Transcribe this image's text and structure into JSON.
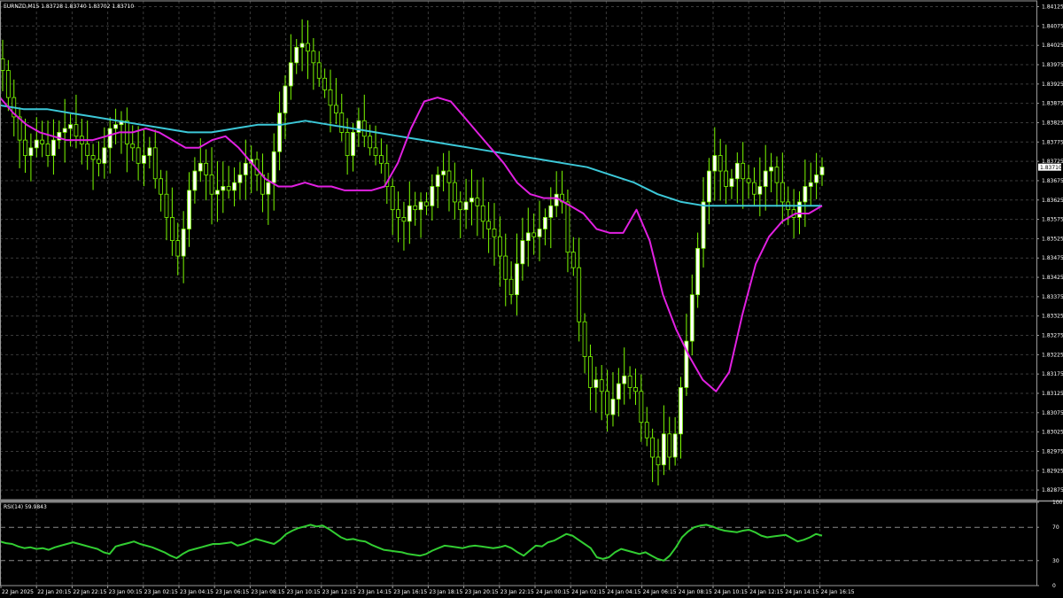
{
  "header": {
    "title": "EURNZD,M15  1.83728 1.83740 1.83702 1.83710"
  },
  "colors": {
    "background": "#000000",
    "grid": "#3a3a3a",
    "bull_candle": "#ffffff",
    "bear_candle": "#000000",
    "candle_outline": "#7cfc00",
    "ma_fast": "#e020e0",
    "ma_slow": "#3cc8d8",
    "rsi_line": "#32cd32",
    "price_tag_bg": "#ffffff",
    "price_tag_text": "#000000"
  },
  "chart_data": [
    {
      "type": "candlestick",
      "title": "EURNZD,M15  1.83728 1.83740 1.83702 1.83710",
      "ylim": [
        1.8285,
        1.8414
      ],
      "y_ticks": [
        "1.84125",
        "1.84075",
        "1.84025",
        "1.83975",
        "1.83925",
        "1.83875",
        "1.83825",
        "1.83775",
        "1.83725",
        "1.83675",
        "1.83625",
        "1.83575",
        "1.83525",
        "1.83475",
        "1.83425",
        "1.83375",
        "1.83325",
        "1.83275",
        "1.83225",
        "1.83175",
        "1.83125",
        "1.83075",
        "1.83025",
        "1.82975",
        "1.82925",
        "1.82875"
      ],
      "x_ticks": [
        "22 Jan 2025",
        "22 Jan 20:15",
        "22 Jan 22:15",
        "23 Jan 00:15",
        "23 Jan 02:15",
        "23 Jan 04:15",
        "23 Jan 06:15",
        "23 Jan 08:15",
        "23 Jan 10:15",
        "23 Jan 12:15",
        "23 Jan 14:15",
        "23 Jan 16:15",
        "23 Jan 18:15",
        "23 Jan 20:15",
        "23 Jan 22:15",
        "24 Jan 00:15",
        "24 Jan 02:15",
        "24 Jan 04:15",
        "24 Jan 06:15",
        "24 Jan 08:15",
        "24 Jan 10:15",
        "24 Jan 12:15",
        "24 Jan 14:15",
        "24 Jan 16:15"
      ],
      "current_price": "1.83710",
      "close_path": [
        1.8396,
        1.8389,
        1.8384,
        1.8378,
        1.8374,
        1.8376,
        1.8378,
        1.8377,
        1.8374,
        1.8378,
        1.838,
        1.8381,
        1.8382,
        1.8379,
        1.8377,
        1.8374,
        1.8373,
        1.8372,
        1.8376,
        1.8381,
        1.8382,
        1.8383,
        1.8377,
        1.8376,
        1.8372,
        1.8374,
        1.8376,
        1.8368,
        1.8364,
        1.8358,
        1.8352,
        1.8348,
        1.8355,
        1.8365,
        1.837,
        1.8372,
        1.8369,
        1.8364,
        1.8365,
        1.8366,
        1.8365,
        1.8367,
        1.8369,
        1.8372,
        1.8373,
        1.8369,
        1.8364,
        1.8367,
        1.8375,
        1.8385,
        1.8392,
        1.8398,
        1.8402,
        1.8403,
        1.8401,
        1.8398,
        1.8394,
        1.8391,
        1.8387,
        1.8385,
        1.838,
        1.8374,
        1.838,
        1.8383,
        1.8379,
        1.8376,
        1.8374,
        1.8372,
        1.8366,
        1.836,
        1.8358,
        1.8357,
        1.8361,
        1.836,
        1.8362,
        1.8361,
        1.8366,
        1.8369,
        1.837,
        1.8367,
        1.8362,
        1.836,
        1.8362,
        1.8363,
        1.8361,
        1.8357,
        1.8355,
        1.8353,
        1.8348,
        1.8342,
        1.8338,
        1.8346,
        1.8352,
        1.8354,
        1.8353,
        1.8355,
        1.8358,
        1.8361,
        1.8364,
        1.8362,
        1.8349,
        1.8345,
        1.8331,
        1.8322,
        1.8314,
        1.8316,
        1.8313,
        1.8307,
        1.8311,
        1.8315,
        1.8317,
        1.8314,
        1.8313,
        1.8305,
        1.8301,
        1.8296,
        1.8294,
        1.8302,
        1.8296,
        1.8302,
        1.8314,
        1.8326,
        1.8338,
        1.835,
        1.8362,
        1.837,
        1.8374,
        1.837,
        1.8366,
        1.8368,
        1.8372,
        1.8368,
        1.8367,
        1.8364,
        1.8366,
        1.837,
        1.8371,
        1.8367,
        1.8362,
        1.836,
        1.8358,
        1.8362,
        1.8366,
        1.8367,
        1.8369,
        1.8371
      ],
      "ma_fast": [
        1.8389,
        1.8385,
        1.8382,
        1.838,
        1.8379,
        1.8378,
        1.8378,
        1.8378,
        1.8379,
        1.838,
        1.838,
        1.8381,
        1.838,
        1.8378,
        1.8376,
        1.8376,
        1.8378,
        1.8379,
        1.8376,
        1.8372,
        1.8368,
        1.8366,
        1.8366,
        1.8367,
        1.8366,
        1.8366,
        1.8365,
        1.8365,
        1.8365,
        1.8366,
        1.8372,
        1.8381,
        1.8388,
        1.8389,
        1.8388,
        1.8384,
        1.838,
        1.8376,
        1.8372,
        1.8367,
        1.8364,
        1.8363,
        1.8363,
        1.8361,
        1.8359,
        1.8355,
        1.8354,
        1.8354,
        1.836,
        1.8352,
        1.8338,
        1.8329,
        1.8322,
        1.8316,
        1.8313,
        1.8318,
        1.8333,
        1.8346,
        1.8353,
        1.8357,
        1.8359,
        1.8359,
        1.8361
      ],
      "ma_slow": [
        1.8387,
        1.8386,
        1.8386,
        1.8385,
        1.8384,
        1.8383,
        1.8382,
        1.8381,
        1.838,
        1.838,
        1.8381,
        1.8382,
        1.8382,
        1.8383,
        1.8382,
        1.8381,
        1.838,
        1.8379,
        1.8378,
        1.8377,
        1.8376,
        1.8375,
        1.8374,
        1.8373,
        1.8372,
        1.8371,
        1.8369,
        1.8367,
        1.8364,
        1.8362,
        1.8361,
        1.8361,
        1.8361,
        1.8361,
        1.8361,
        1.8361
      ]
    },
    {
      "type": "line",
      "title": "RSI(14) 59.9843",
      "ylim": [
        0,
        100
      ],
      "y_ticks": [
        "100",
        "70",
        "30",
        "0"
      ],
      "levels": [
        70,
        30
      ],
      "values": [
        53,
        51,
        50,
        47,
        45,
        46,
        44,
        45,
        43,
        46,
        48,
        50,
        52,
        50,
        48,
        46,
        44,
        40,
        38,
        47,
        49,
        51,
        53,
        50,
        48,
        46,
        43,
        40,
        36,
        33,
        38,
        42,
        44,
        46,
        48,
        50,
        50,
        51,
        52,
        48,
        50,
        53,
        56,
        54,
        52,
        50,
        55,
        62,
        66,
        69,
        71,
        73,
        71,
        72,
        68,
        63,
        58,
        55,
        56,
        54,
        53,
        49,
        46,
        43,
        42,
        41,
        40,
        38,
        37,
        36,
        38,
        42,
        45,
        48,
        47,
        46,
        45,
        47,
        48,
        47,
        46,
        45,
        46,
        48,
        45,
        40,
        36,
        42,
        48,
        47,
        52,
        54,
        58,
        62,
        60,
        55,
        50,
        45,
        34,
        32,
        34,
        40,
        44,
        42,
        40,
        38,
        40,
        36,
        32,
        30,
        36,
        46,
        58,
        65,
        70,
        72,
        73,
        71,
        68,
        66,
        65,
        64,
        66,
        67,
        64,
        60,
        58,
        59,
        60,
        61,
        57,
        53,
        55,
        58,
        62,
        60
      ]
    }
  ]
}
